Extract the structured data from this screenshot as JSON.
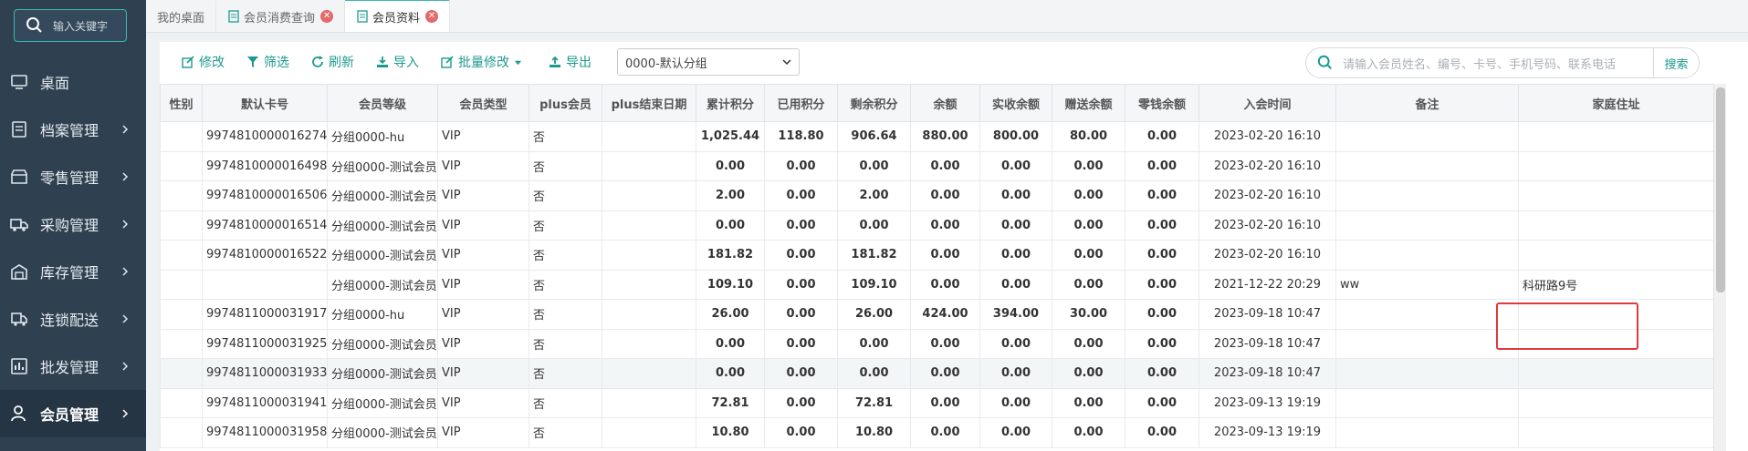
{
  "sidebar": {
    "search_label": "输入关键字",
    "items": [
      {
        "label": "桌面",
        "icon": "monitor-icon"
      },
      {
        "label": "档案管理",
        "icon": "archive-icon"
      },
      {
        "label": "零售管理",
        "icon": "store-icon"
      },
      {
        "label": "采购管理",
        "icon": "truck-icon"
      },
      {
        "label": "库存管理",
        "icon": "warehouse-icon"
      },
      {
        "label": "连锁配送",
        "icon": "delivery-icon"
      },
      {
        "label": "批发管理",
        "icon": "chart-icon"
      },
      {
        "label": "会员管理",
        "icon": "user-icon",
        "active": true
      }
    ]
  },
  "tabs": [
    {
      "label": "我的桌面"
    },
    {
      "label": "会员消费查询"
    },
    {
      "label": "会员资料",
      "active": true
    }
  ],
  "toolbar": {
    "edit": "修改",
    "filter": "筛选",
    "refresh": "刷新",
    "import": "导入",
    "batch_edit": "批量修改",
    "export": "导出",
    "group_select": "0000-默认分组"
  },
  "search": {
    "placeholder": "请输入会员姓名、编号、卡号、手机号码、联系电话",
    "button": "搜索"
  },
  "table": {
    "headers": [
      "性别",
      "默认卡号",
      "会员等级",
      "会员类型",
      "plus会员",
      "plus结束日期",
      "累计积分",
      "已用积分",
      "剩余积分",
      "余额",
      "实收余额",
      "赠送余额",
      "零钱余额",
      "入会时间",
      "备注",
      "家庭住址"
    ],
    "rows": [
      [
        "",
        "9974810000016274",
        "分组0000-hu",
        "VIP",
        "否",
        "",
        "1,025.44",
        "118.80",
        "906.64",
        "880.00",
        "800.00",
        "80.00",
        "0.00",
        "2023-02-20 16:10",
        "",
        ""
      ],
      [
        "",
        "9974810000016498",
        "分组0000-测试会员",
        "VIP",
        "否",
        "",
        "0.00",
        "0.00",
        "0.00",
        "0.00",
        "0.00",
        "0.00",
        "0.00",
        "2023-02-20 16:10",
        "",
        ""
      ],
      [
        "",
        "9974810000016506",
        "分组0000-测试会员",
        "VIP",
        "否",
        "",
        "2.00",
        "0.00",
        "2.00",
        "0.00",
        "0.00",
        "0.00",
        "0.00",
        "2023-02-20 16:10",
        "",
        ""
      ],
      [
        "",
        "9974810000016514",
        "分组0000-测试会员",
        "VIP",
        "否",
        "",
        "0.00",
        "0.00",
        "0.00",
        "0.00",
        "0.00",
        "0.00",
        "0.00",
        "2023-02-20 16:10",
        "",
        ""
      ],
      [
        "",
        "9974810000016522",
        "分组0000-测试会员",
        "VIP",
        "否",
        "",
        "181.82",
        "0.00",
        "181.82",
        "0.00",
        "0.00",
        "0.00",
        "0.00",
        "2023-02-20 16:10",
        "",
        ""
      ],
      [
        "",
        "",
        "分组0000-测试会员",
        "VIP",
        "否",
        "",
        "109.10",
        "0.00",
        "109.10",
        "0.00",
        "0.00",
        "0.00",
        "0.00",
        "2021-12-22 20:29",
        "ww",
        "科研路9号"
      ],
      [
        "",
        "9974811000031917",
        "分组0000-hu",
        "VIP",
        "否",
        "",
        "26.00",
        "0.00",
        "26.00",
        "424.00",
        "394.00",
        "30.00",
        "0.00",
        "2023-09-18 10:47",
        "",
        ""
      ],
      [
        "",
        "9974811000031925",
        "分组0000-测试会员",
        "VIP",
        "否",
        "",
        "0.00",
        "0.00",
        "0.00",
        "0.00",
        "0.00",
        "0.00",
        "0.00",
        "2023-09-18 10:47",
        "",
        ""
      ],
      [
        "",
        "9974811000031933",
        "分组0000-测试会员",
        "VIP",
        "否",
        "",
        "0.00",
        "0.00",
        "0.00",
        "0.00",
        "0.00",
        "0.00",
        "0.00",
        "2023-09-18 10:47",
        "",
        ""
      ],
      [
        "",
        "9974811000031941",
        "分组0000-测试会员",
        "VIP",
        "否",
        "",
        "72.81",
        "0.00",
        "72.81",
        "0.00",
        "0.00",
        "0.00",
        "0.00",
        "2023-09-13 19:19",
        "",
        ""
      ],
      [
        "",
        "9974811000031958",
        "分组0000-测试会员",
        "VIP",
        "否",
        "",
        "10.80",
        "0.00",
        "10.80",
        "0.00",
        "0.00",
        "0.00",
        "0.00",
        "2023-09-13 19:19",
        "",
        ""
      ]
    ]
  },
  "colors": {
    "accent": "#1d9a8f",
    "sidebar_bg": "#2f4050",
    "highlight_box": "#e03a3a"
  }
}
